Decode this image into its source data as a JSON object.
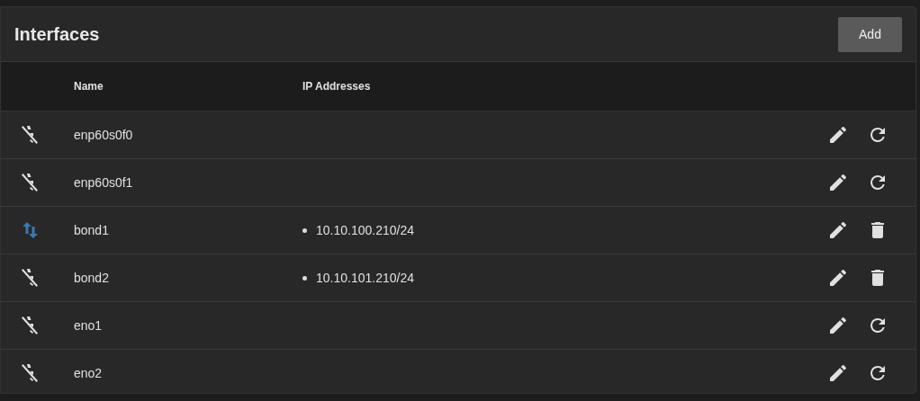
{
  "card": {
    "title": "Interfaces",
    "add_button": "Add"
  },
  "table": {
    "columns": [
      "Name",
      "IP Addresses"
    ],
    "rows": [
      {
        "status_icon": {
          "kind": "down"
        },
        "name": "enp60s0f0",
        "ip_addresses": [],
        "action_icon": {
          "kind": "reset"
        }
      },
      {
        "status_icon": {
          "kind": "down"
        },
        "name": "enp60s0f1",
        "ip_addresses": [],
        "action_icon": {
          "kind": "reset"
        }
      },
      {
        "status_icon": {
          "kind": "up"
        },
        "name": "bond1",
        "ip_addresses": [
          "10.10.100.210/24"
        ],
        "action_icon": {
          "kind": "delete"
        }
      },
      {
        "status_icon": {
          "kind": "down"
        },
        "name": "bond2",
        "ip_addresses": [
          "10.10.101.210/24"
        ],
        "action_icon": {
          "kind": "delete"
        }
      },
      {
        "status_icon": {
          "kind": "down"
        },
        "name": "eno1",
        "ip_addresses": [],
        "action_icon": {
          "kind": "reset"
        }
      },
      {
        "status_icon": {
          "kind": "down"
        },
        "name": "eno2",
        "ip_addresses": [],
        "action_icon": {
          "kind": "reset"
        }
      }
    ]
  }
}
